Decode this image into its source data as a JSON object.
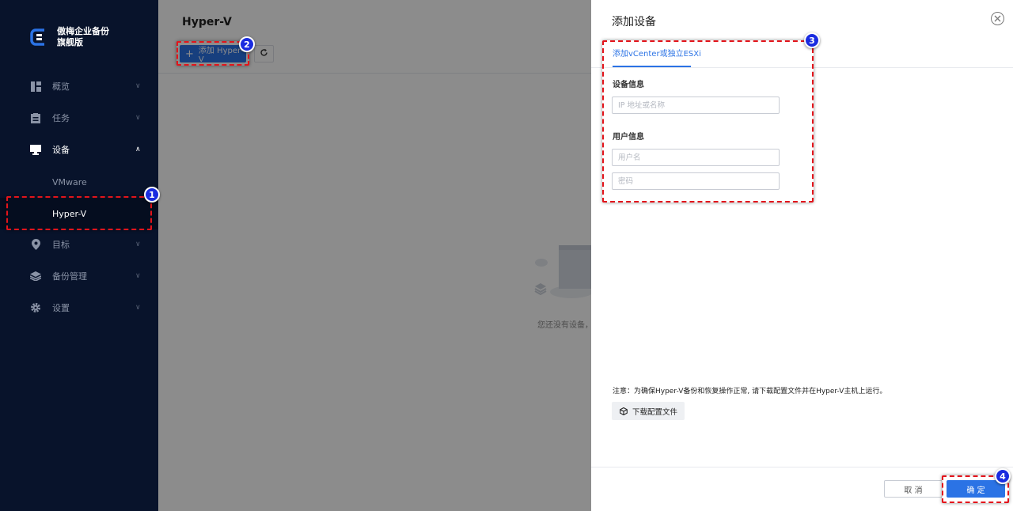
{
  "sidebar": {
    "logo_line1": "傲梅企业备份",
    "logo_line2": "旗舰版",
    "items": [
      {
        "label": "概览",
        "icon": "dashboard-icon"
      },
      {
        "label": "任务",
        "icon": "task-icon"
      },
      {
        "label": "设备",
        "icon": "monitor-icon"
      },
      {
        "label": "目标",
        "icon": "location-pin-icon"
      },
      {
        "label": "备份管理",
        "icon": "layers-icon"
      },
      {
        "label": "设置",
        "icon": "gear-icon"
      }
    ],
    "subitems": [
      {
        "label": "VMware"
      },
      {
        "label": "Hyper-V"
      }
    ]
  },
  "main": {
    "title": "Hyper-V",
    "add_button": "添加 Hyper-V",
    "empty_text": "您还没有设备，"
  },
  "drawer": {
    "title": "添加设备",
    "tab": "添加vCenter或独立ESXi",
    "device_info_label": "设备信息",
    "ip_placeholder": "IP 地址或名称",
    "user_info_label": "用户信息",
    "username_placeholder": "用户名",
    "password_placeholder": "密码",
    "note": "注意：为确保Hyper-V备份和恢复操作正常, 请下载配置文件并在Hyper-V主机上运行。",
    "download_button": "下载配置文件",
    "cancel_button": "取 消",
    "ok_button": "确 定"
  },
  "annotations": {
    "badge1": "1",
    "badge2": "2",
    "badge3": "3",
    "badge4": "4"
  },
  "colors": {
    "sidebar_bg": "#08132b",
    "accent": "#2b73e5",
    "highlight": "#e3141b",
    "badge": "#1a2ce0"
  }
}
